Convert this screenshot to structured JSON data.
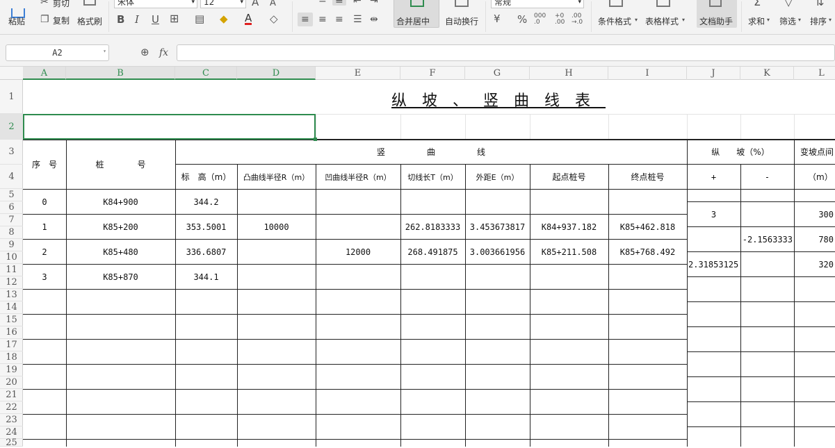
{
  "ribbon": {
    "paste": "粘贴",
    "cut": "剪切",
    "copy": "复制",
    "format_painter": "格式刷",
    "font_name": "宋体",
    "font_size": "12",
    "merge_center": "合并居中",
    "wrap_text": "自动换行",
    "number_format": "常规",
    "conditional_format": "条件格式",
    "table_style": "表格样式",
    "doc_assistant": "文档助手",
    "sum": "求和",
    "filter": "筛选",
    "sort": "排序"
  },
  "formula_bar": {
    "name_box": "A2",
    "fx": "fx",
    "formula": ""
  },
  "columns": [
    "A",
    "B",
    "C",
    "D",
    "E",
    "F",
    "G",
    "H",
    "I",
    "J",
    "K",
    "L"
  ],
  "rows": [
    "1",
    "2",
    "3",
    "4",
    "5",
    "6",
    "7",
    "8",
    "9",
    "10",
    "11",
    "12",
    "13",
    "14",
    "15",
    "16",
    "17",
    "18",
    "19",
    "20",
    "21",
    "22",
    "23",
    "24",
    "25"
  ],
  "sheet": {
    "title": "纵坡、竖曲线表",
    "header": {
      "seq": "序　号",
      "station": "桩　　　　号",
      "vertical_curve": "竖　　　　　曲　　　　　线",
      "elevation": "标　高（m）",
      "convex_radius": "凸曲线半径R（m）",
      "concave_radius": "凹曲线半径R（m）",
      "tangent_length": "切线长T（m）",
      "external_distance": "外距E（m）",
      "start_station": "起点桩号",
      "end_station": "终点桩号",
      "grade": "纵　　坡（%）",
      "grade_plus": "+",
      "grade_minus": "-",
      "grade_change": "变坡点间",
      "grade_change_unit": "（m）"
    },
    "data_rows": [
      {
        "seq": "0",
        "station": "K84+900",
        "elevation": "344.2",
        "convex": "",
        "concave": "",
        "t": "",
        "e": "",
        "start": "",
        "end": ""
      },
      {
        "seq": "1",
        "station": "K85+200",
        "elevation": "353.5001",
        "convex": "10000",
        "concave": "",
        "t": "262.8183333",
        "e": "3.453673817",
        "start": "K84+937.182",
        "end": "K85+462.818"
      },
      {
        "seq": "2",
        "station": "K85+480",
        "elevation": "336.6807",
        "convex": "",
        "concave": "12000",
        "t": "268.491875",
        "e": "3.003661956",
        "start": "K85+211.508",
        "end": "K85+768.492"
      },
      {
        "seq": "3",
        "station": "K85+870",
        "elevation": "344.1",
        "convex": "",
        "concave": "",
        "t": "",
        "e": "",
        "start": "",
        "end": ""
      }
    ],
    "grades": [
      {
        "plus": "3",
        "minus": "",
        "length": "300"
      },
      {
        "plus": "",
        "minus": "-2.1563333",
        "length": "780"
      },
      {
        "plus": "2.31853125",
        "minus": "",
        "length": "320"
      }
    ]
  }
}
